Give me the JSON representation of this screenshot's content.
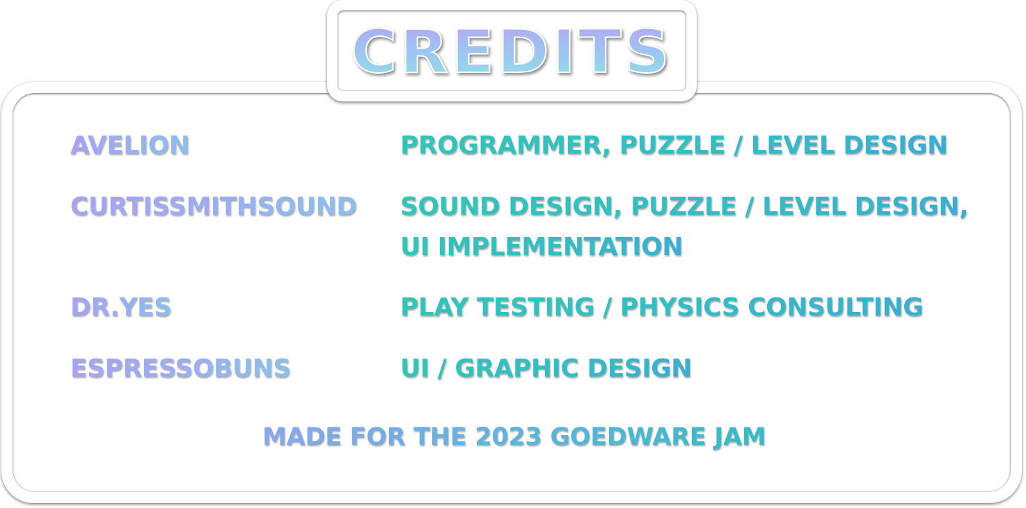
{
  "title": "CREDITS",
  "credits": [
    {
      "name": "AVELION",
      "role_lines": [
        "PROGRAMMER, PUZZLE / LEVEL DESIGN"
      ]
    },
    {
      "name": "CURTISSMITHSOUND",
      "role_lines": [
        "SOUND DESIGN, PUZZLE / LEVEL DESIGN,",
        "UI IMPLEMENTATION"
      ]
    },
    {
      "name": "DR.YES",
      "role_lines": [
        "PLAY TESTING / PHYSICS CONSULTING"
      ]
    },
    {
      "name": "ESPRESSOBUNS",
      "role_lines": [
        "UI / GRAPHIC DESIGN"
      ]
    }
  ],
  "footer": "MADE FOR THE 2023 GOEDWARE JAM",
  "colors": {
    "name_gradient": [
      "#a8a2f6",
      "#8bc0ec"
    ],
    "role_gradient": [
      "#2fc6b8",
      "#3aaed4"
    ],
    "title_gradient": [
      "#b2a8f4",
      "#8fe0e6"
    ],
    "panel_background": "#ffffff"
  }
}
